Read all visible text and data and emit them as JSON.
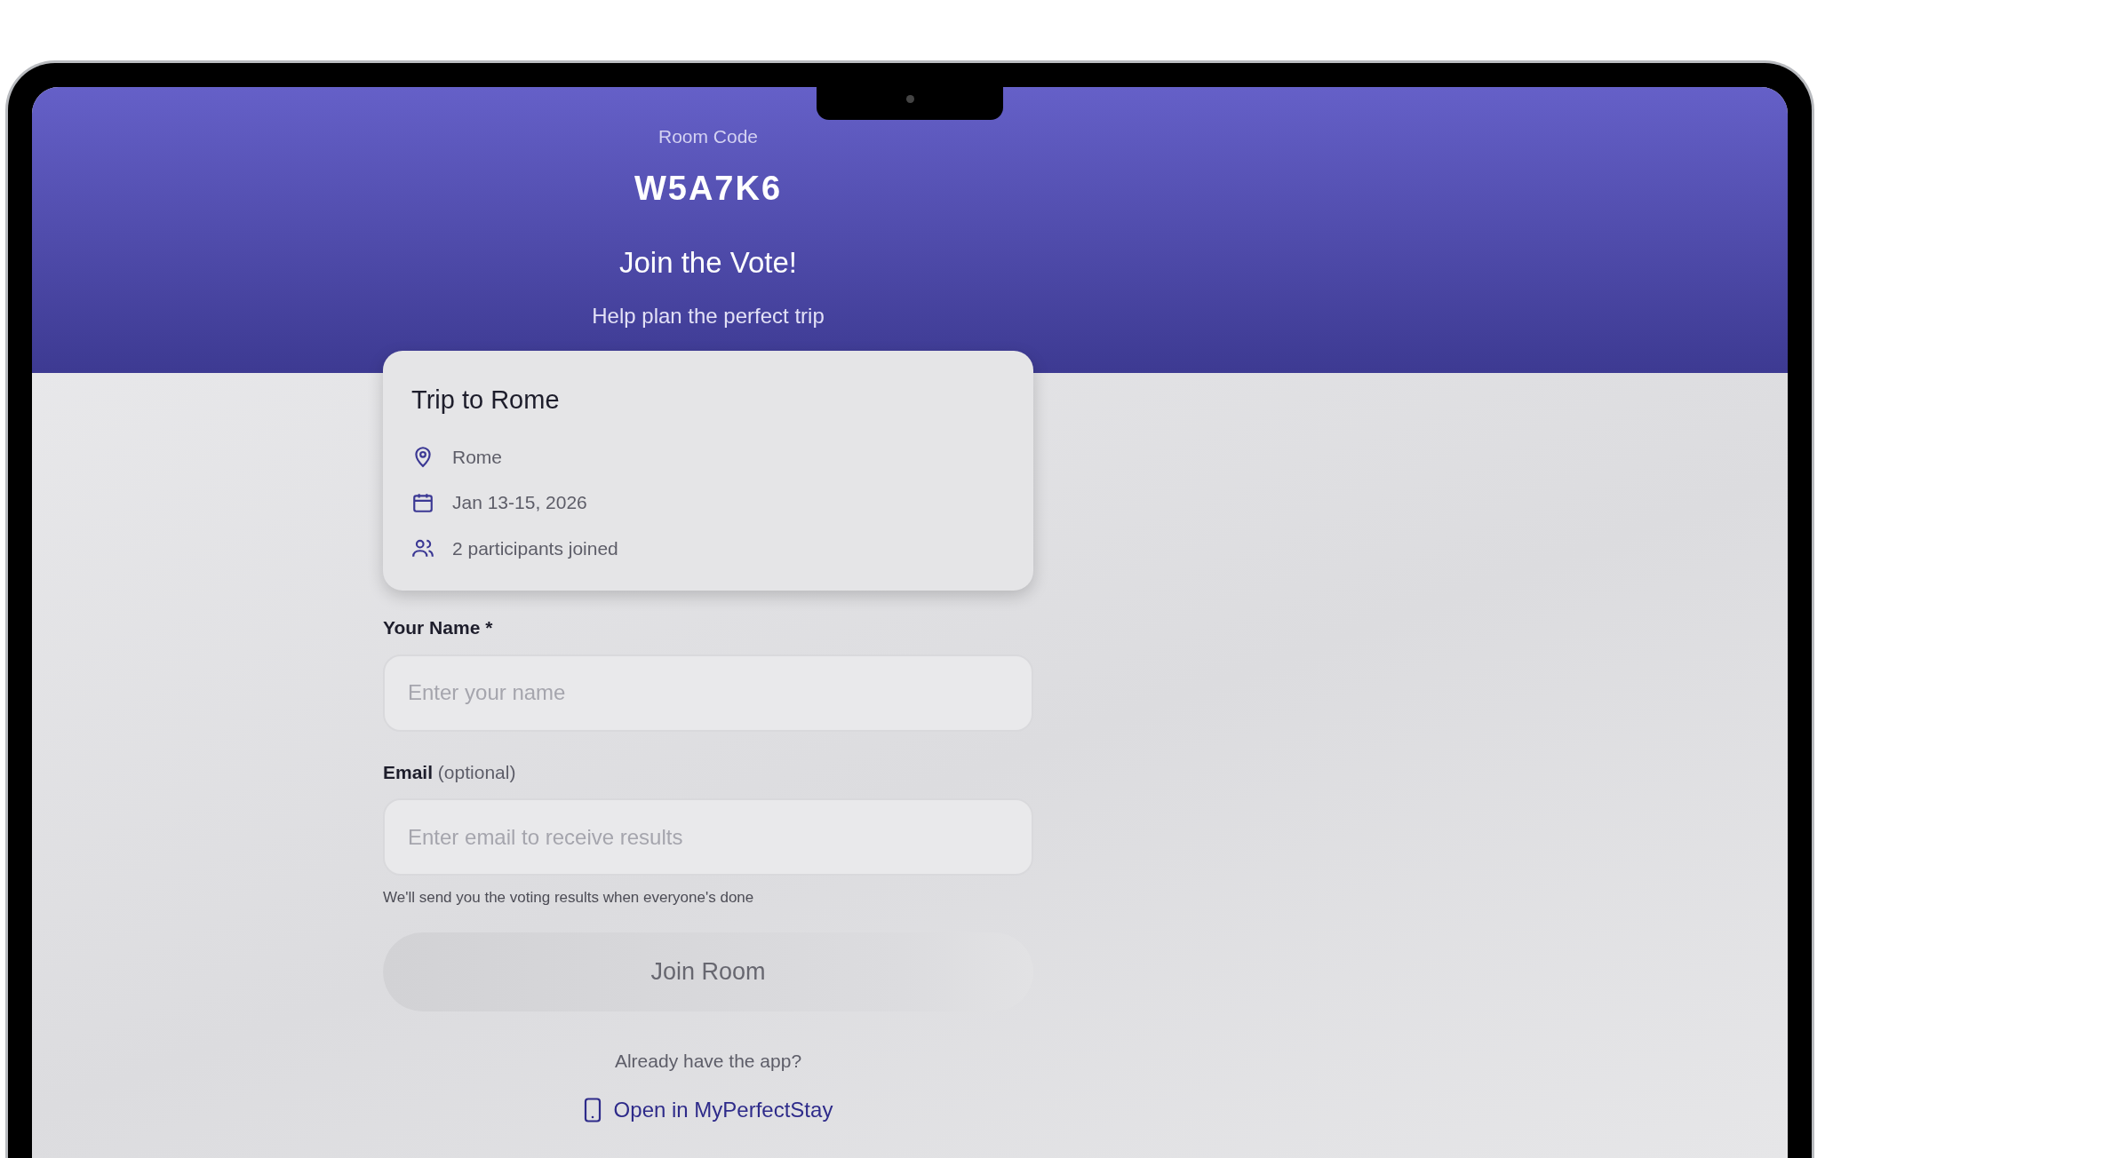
{
  "header": {
    "room_code_label": "Room Code",
    "room_code": "W5A7K6",
    "title": "Join the Vote!",
    "subtitle": "Help plan the perfect trip"
  },
  "trip_card": {
    "title": "Trip to Rome",
    "details": [
      {
        "kind": "location",
        "text": "Rome"
      },
      {
        "kind": "date",
        "text": "Jan 13-15, 2026"
      },
      {
        "kind": "people",
        "text": "2 participants joined"
      }
    ]
  },
  "form": {
    "fields": [
      {
        "label": "Your Name *",
        "placeholder": "Enter your name"
      },
      {
        "label": "Email",
        "label_note": "(optional)",
        "placeholder": "Enter email to receive results",
        "help": "We'll send you the voting results when everyone's done"
      }
    ],
    "submit": {
      "label": "Join Room",
      "disabled": true
    }
  },
  "app_prompt": {
    "text": "Already have the app?",
    "link": "Open in MyPerfectStay"
  }
}
